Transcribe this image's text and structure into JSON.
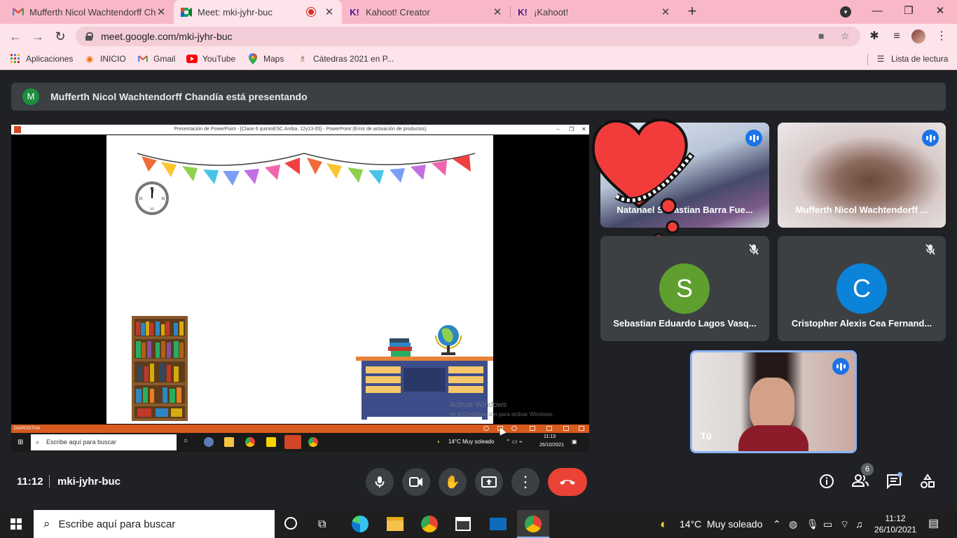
{
  "browser": {
    "tabs": [
      {
        "title": "Mufferth Nicol Wachtendorff Cha",
        "icon": "gmail-icon"
      },
      {
        "title": "Meet: mki-jyhr-buc",
        "icon": "meet-icon",
        "recording": true
      },
      {
        "title": "Kahoot! Creator",
        "icon": "kahoot-icon"
      },
      {
        "title": "¡Kahoot!",
        "icon": "kahoot-icon"
      }
    ],
    "url": "meet.google.com/mki-jyhr-buc",
    "bookmarks": [
      "Aplicaciones",
      "INICIO",
      "Gmail",
      "YouTube",
      "Maps",
      "Cátedras 2021 en P..."
    ],
    "reading_list": "Lista de lectura",
    "accent": "#f8b8c8"
  },
  "meet": {
    "presenter_banner": "Mufferth Nicol Wachtendorff Chandía está presentando",
    "presenter_initial": "M",
    "presentation": {
      "window_title": "Presentación de PowerPoint - [Clase 6 quintoESC Arriba. 12y13-05] - PowerPoint (Error de activación de productos)",
      "status_label": "DIAPOSITIVA",
      "inner_search": "Escribe aquí para buscar",
      "inner_weather": "14°C  Muy soleado",
      "inner_time": "11:13",
      "inner_date": "26/10/2021",
      "activate_title": "Activar Windows",
      "activate_sub": "Ve a Configuración para activar Windows."
    },
    "participants": [
      {
        "name": "Natanael Sebastian Barra Fue...",
        "state": "speaking"
      },
      {
        "name": "Mufferth Nicol Wachtendorff ...",
        "state": "speaking"
      },
      {
        "name": "Sebastian Eduardo Lagos Vasq...",
        "initial": "S",
        "color": "#5e9f2f",
        "state": "muted"
      },
      {
        "name": "Cristopher Alexis Cea Fernand...",
        "initial": "C",
        "color": "#0b83d9",
        "state": "muted"
      },
      {
        "name": "Tú",
        "state": "speaking"
      }
    ],
    "time": "11:12",
    "meeting_code": "mki-jyhr-buc",
    "people_count": "6"
  },
  "taskbar": {
    "search_placeholder": "Escribe aquí para buscar",
    "temperature": "14°C",
    "weather": "Muy soleado",
    "time": "11:12",
    "date": "26/10/2021"
  }
}
